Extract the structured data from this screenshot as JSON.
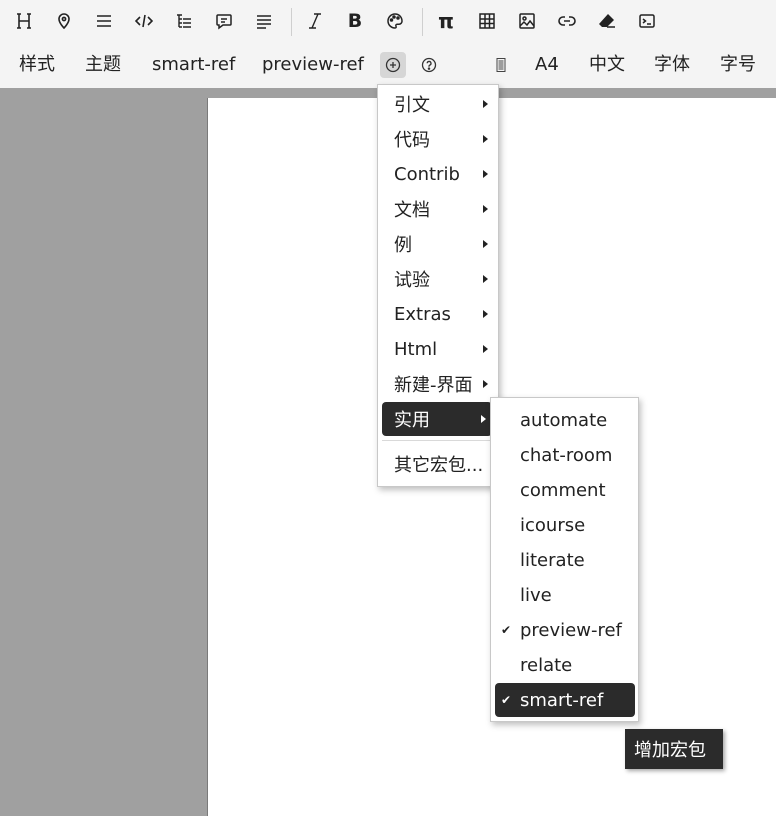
{
  "toolbar": {
    "row1_icons": [
      "heading-icon",
      "location-pin-icon",
      "list-icon",
      "code-icon",
      "outline-icon",
      "comment-icon",
      "paragraph-icon",
      "italic-icon",
      "bold-icon",
      "palette-icon",
      "pi-icon",
      "table-icon",
      "image-icon",
      "link-icon",
      "eraser-icon",
      "terminal-icon"
    ],
    "bold_glyph": "B",
    "pi_glyph": "π",
    "menus": {
      "style": "样式",
      "theme": "主题",
      "smart_ref": "smart-ref",
      "preview_ref": "preview-ref",
      "paper": "A4",
      "language": "中文",
      "font": "字体",
      "font_size": "字号"
    }
  },
  "dropdown": {
    "items": [
      {
        "label": "引文",
        "has_submenu": true
      },
      {
        "label": "代码",
        "has_submenu": true
      },
      {
        "label": "Contrib",
        "has_submenu": true
      },
      {
        "label": "文档",
        "has_submenu": true
      },
      {
        "label": "例",
        "has_submenu": true
      },
      {
        "label": "试验",
        "has_submenu": true
      },
      {
        "label": "Extras",
        "has_submenu": true
      },
      {
        "label": "Html",
        "has_submenu": true
      },
      {
        "label": "新建-界面",
        "has_submenu": true
      },
      {
        "label": "实用",
        "has_submenu": true,
        "selected": true
      }
    ],
    "other_packages": "其它宏包..."
  },
  "submenu": {
    "check_glyph": "✔",
    "items": [
      {
        "label": "automate",
        "checked": false
      },
      {
        "label": "chat-room",
        "checked": false
      },
      {
        "label": "comment",
        "checked": false
      },
      {
        "label": "icourse",
        "checked": false
      },
      {
        "label": "literate",
        "checked": false
      },
      {
        "label": "live",
        "checked": false
      },
      {
        "label": "preview-ref",
        "checked": true
      },
      {
        "label": "relate",
        "checked": false
      },
      {
        "label": "smart-ref",
        "checked": true,
        "selected": true
      }
    ]
  },
  "tooltip": {
    "text": "增加宏包"
  }
}
